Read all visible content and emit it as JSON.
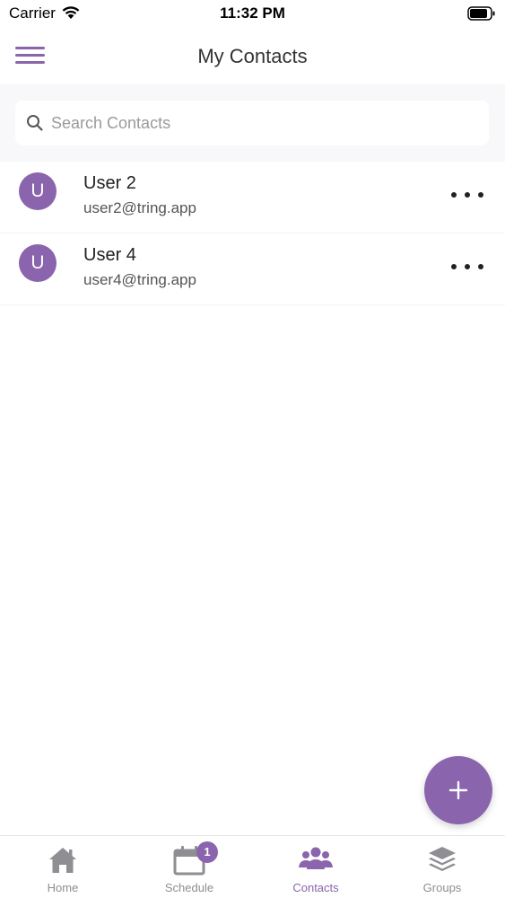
{
  "status_bar": {
    "carrier": "Carrier",
    "time": "11:32 PM"
  },
  "header": {
    "title": "My Contacts",
    "menu_icon": "hamburger-menu-icon"
  },
  "search": {
    "placeholder": "Search Contacts",
    "value": "",
    "icon": "search-icon"
  },
  "contacts": [
    {
      "initial": "U",
      "name": "User 2",
      "email": "user2@tring.app"
    },
    {
      "initial": "U",
      "name": "User 4",
      "email": "user4@tring.app"
    }
  ],
  "fab": {
    "icon": "plus-icon"
  },
  "tabs": [
    {
      "label": "Home",
      "icon": "home-icon",
      "active": false
    },
    {
      "label": "Schedule",
      "icon": "calendar-icon",
      "active": false,
      "badge": "1"
    },
    {
      "label": "Contacts",
      "icon": "people-icon",
      "active": true
    },
    {
      "label": "Groups",
      "icon": "layers-icon",
      "active": false
    }
  ],
  "colors": {
    "accent": "#8a64ad",
    "inactive_tab": "#8e8e93",
    "search_bg": "#f8f7f9"
  }
}
